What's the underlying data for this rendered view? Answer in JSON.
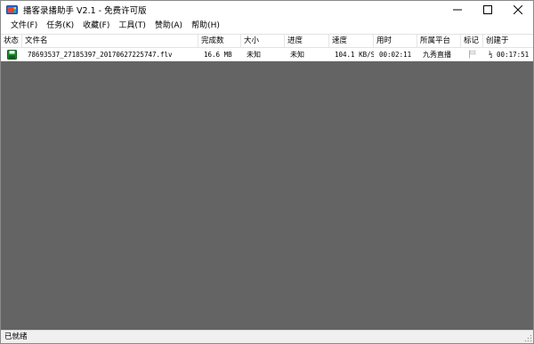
{
  "window": {
    "title": "播客录播助手 V2.1 - 免费许可版"
  },
  "menu": [
    {
      "label": "文件(F)"
    },
    {
      "label": "任务(K)"
    },
    {
      "label": "收藏(F)"
    },
    {
      "label": "工具(T)"
    },
    {
      "label": "赞助(A)"
    },
    {
      "label": "帮助(H)"
    }
  ],
  "table": {
    "columns": [
      {
        "label": "状态"
      },
      {
        "label": "文件名"
      },
      {
        "label": "完成数"
      },
      {
        "label": "大小"
      },
      {
        "label": "进度"
      },
      {
        "label": "速度"
      },
      {
        "label": "用时"
      },
      {
        "label": "所属平台"
      },
      {
        "label": "标记"
      },
      {
        "label": "创建于"
      }
    ],
    "rows": [
      {
        "status_icon": "save-disk-icon",
        "filename": "78693537_27185397_20170627225747.flv",
        "completed": "16.6 MB",
        "size": "未知",
        "progress": "未知",
        "speed": "104.1 KB/S",
        "elapsed": "00:02:11",
        "platform": "九秀直播",
        "flag_icon": "flag-icon",
        "created": "½ 00:17:51"
      }
    ]
  },
  "status_bar": {
    "text": "已就绪"
  },
  "colors": {
    "content_bg": "#646464",
    "status_icon_green": "#1a8a2e"
  }
}
